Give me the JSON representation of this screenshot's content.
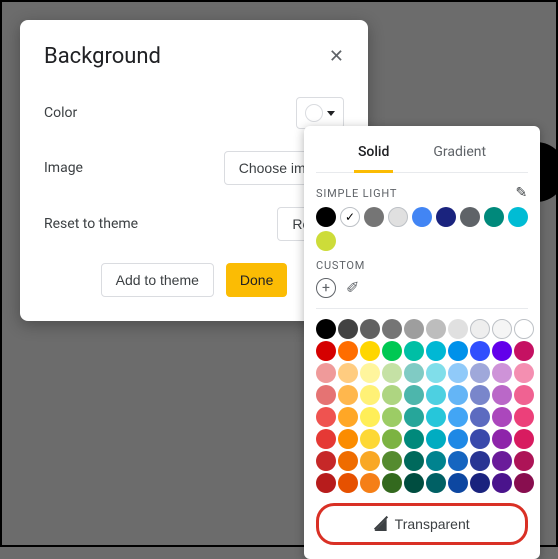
{
  "dialog": {
    "title": "Background",
    "color_label": "Color",
    "image_label": "Image",
    "choose_image": "Choose image",
    "reset_label": "Reset to theme",
    "reset_button": "Reset",
    "add_to_theme": "Add to theme",
    "done": "Done"
  },
  "picker": {
    "tab_solid": "Solid",
    "tab_gradient": "Gradient",
    "section_simple": "SIMPLE LIGHT",
    "section_custom": "CUSTOM",
    "transparent": "Transparent",
    "simple_colors": [
      "#000000",
      "#ffffff",
      "#757575",
      "#e0e0e0",
      "#4285f4",
      "#1a237e",
      "#5f6368",
      "#00897b",
      "#00bcd4",
      "#cddc39"
    ],
    "grid_colors": [
      "#000000",
      "#424242",
      "#616161",
      "#757575",
      "#9e9e9e",
      "#bdbdbd",
      "#e0e0e0",
      "#eeeeee",
      "#f5f5f5",
      "#ffffff",
      "#d50000",
      "#ff6d00",
      "#ffd600",
      "#00c853",
      "#00bfa5",
      "#00b8d4",
      "#0091ea",
      "#304ffe",
      "#6200ea",
      "#c51162",
      "#ef9a9a",
      "#ffcc80",
      "#fff59d",
      "#c5e1a5",
      "#80cbc4",
      "#80deea",
      "#90caf9",
      "#9fa8da",
      "#ce93d8",
      "#f48fb1",
      "#e57373",
      "#ffb74d",
      "#fff176",
      "#aed581",
      "#4db6ac",
      "#4dd0e1",
      "#64b5f6",
      "#7986cb",
      "#ba68c8",
      "#f06292",
      "#ef5350",
      "#ffa726",
      "#ffee58",
      "#9ccc65",
      "#26a69a",
      "#26c6da",
      "#42a5f5",
      "#5c6bc0",
      "#ab47bc",
      "#ec407a",
      "#e53935",
      "#fb8c00",
      "#fdd835",
      "#7cb342",
      "#00897b",
      "#00acc1",
      "#1e88e5",
      "#3949ab",
      "#8e24aa",
      "#d81b60",
      "#c62828",
      "#ef6c00",
      "#f9a825",
      "#558b2f",
      "#00695c",
      "#00838f",
      "#1565c0",
      "#283593",
      "#6a1b9a",
      "#ad1457",
      "#b71c1c",
      "#e65100",
      "#f57f17",
      "#33691e",
      "#004d40",
      "#006064",
      "#0d47a1",
      "#1a237e",
      "#4a148c",
      "#880e4f"
    ]
  }
}
